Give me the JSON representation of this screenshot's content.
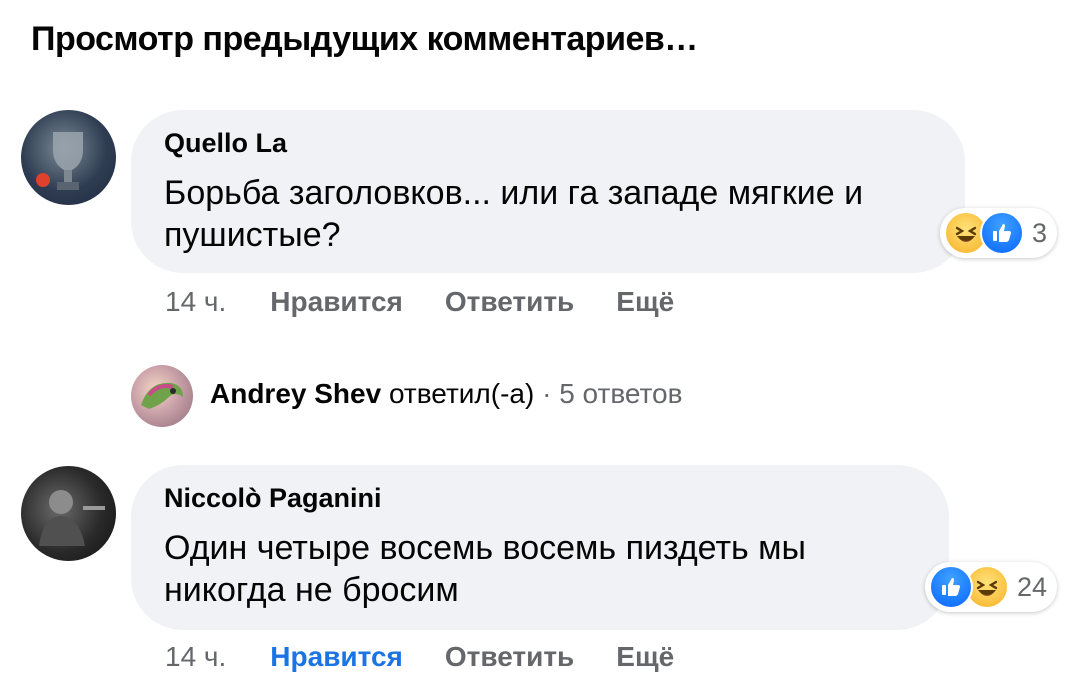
{
  "view_previous": "Просмотр предыдущих комментариев…",
  "comments": [
    {
      "author": "Quello La",
      "text": "Борьба заголовков... или га западе мягкие и пушистые?",
      "reaction_count": "3",
      "reactions": [
        "haha-icon",
        "like-icon"
      ],
      "time": "14 ч.",
      "like_label": "Нравится",
      "reply_label": "Ответить",
      "more_label": "Ещё",
      "liked": false
    },
    {
      "author": "Niccolò Paganini",
      "text": "Один четыре восемь восемь пиздеть мы никогда не бросим",
      "reaction_count": "24",
      "reactions": [
        "like-icon",
        "haha-icon"
      ],
      "time": "14 ч.",
      "like_label": "Нравится",
      "reply_label": "Ответить",
      "more_label": "Ещё",
      "liked": true
    }
  ],
  "reply_summary": {
    "name": "Andrey Shev",
    "verb": "ответил(-а)",
    "separator": "·",
    "count": "5 ответов"
  },
  "colors": {
    "bubble": "#f0f2f5",
    "secondary_text": "#65676b",
    "liked_blue": "#1b74e4",
    "like_icon": "#0866ff",
    "haha_icon": "#f7b125"
  }
}
